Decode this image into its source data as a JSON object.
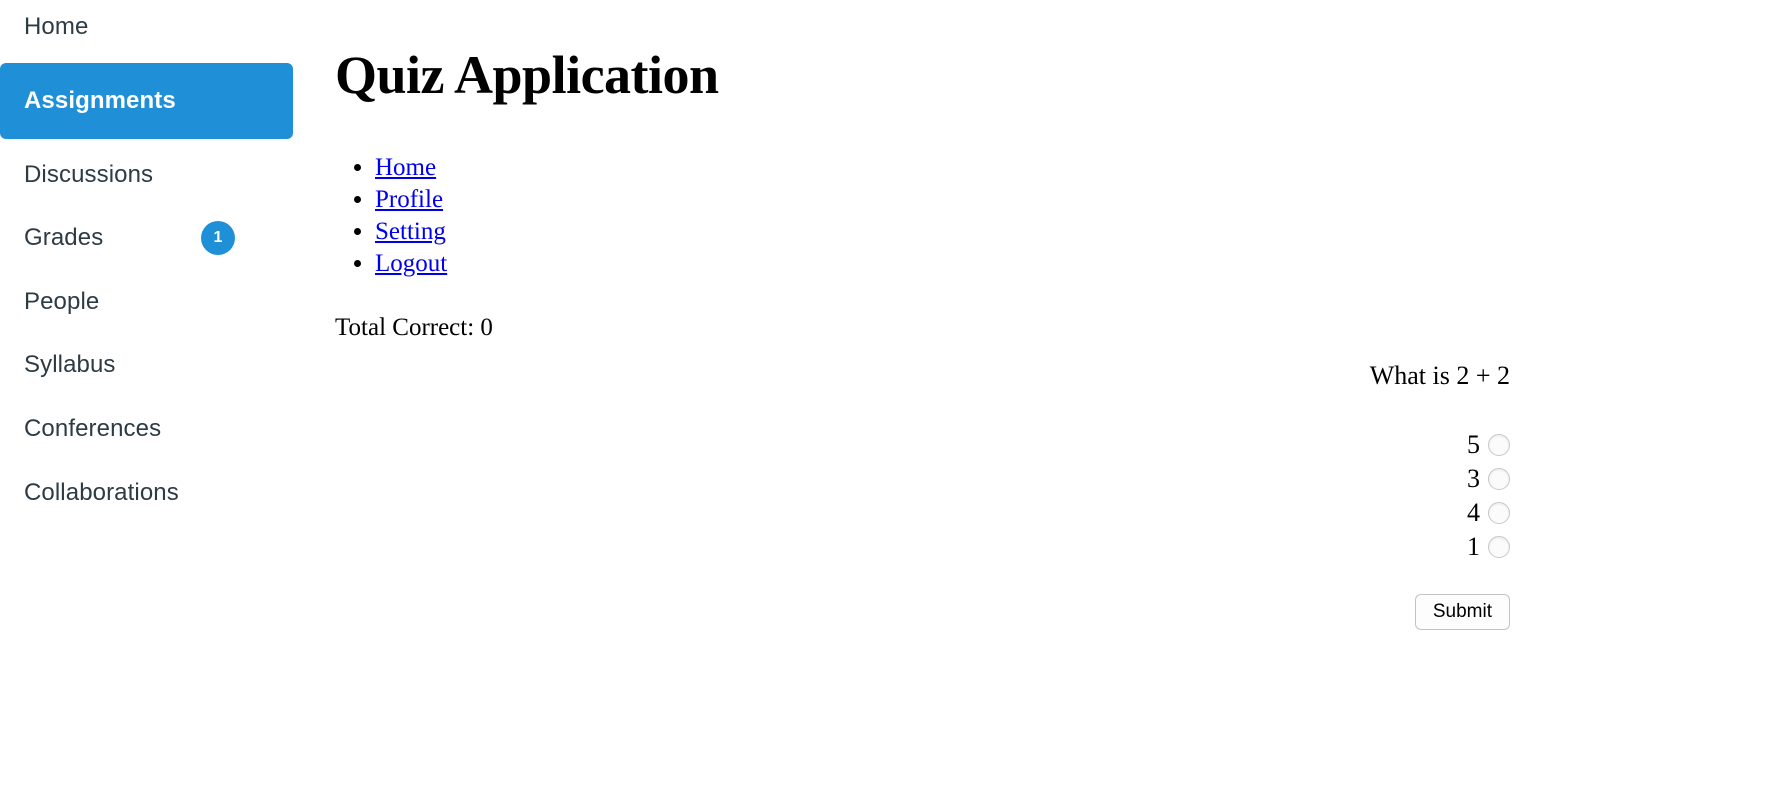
{
  "sidebar": {
    "items": [
      {
        "id": "home",
        "label": "Home",
        "active": false,
        "badge": null
      },
      {
        "id": "assignments",
        "label": "Assignments",
        "active": true,
        "badge": null
      },
      {
        "id": "discussions",
        "label": "Discussions",
        "active": false,
        "badge": null
      },
      {
        "id": "grades",
        "label": "Grades",
        "active": false,
        "badge": "1"
      },
      {
        "id": "people",
        "label": "People",
        "active": false,
        "badge": null
      },
      {
        "id": "syllabus",
        "label": "Syllabus",
        "active": false,
        "badge": null
      },
      {
        "id": "conferences",
        "label": "Conferences",
        "active": false,
        "badge": null
      },
      {
        "id": "collaborations",
        "label": "Collaborations",
        "active": false,
        "badge": null
      }
    ],
    "active_color": "#1f90d8",
    "text_color": "#2D3B45",
    "badge_color": "#1f90d8"
  },
  "main": {
    "title": "Quiz Application",
    "links": [
      {
        "label": "Home"
      },
      {
        "label": "Profile"
      },
      {
        "label": "Setting"
      },
      {
        "label": "Logout"
      }
    ],
    "link_color": "#0000EE",
    "total_correct_text": "Total Correct: 0",
    "total_correct_value": 0
  },
  "quiz": {
    "question": "What is 2 + 2",
    "options": [
      {
        "label": "5",
        "selected": false
      },
      {
        "label": "3",
        "selected": false
      },
      {
        "label": "4",
        "selected": false
      },
      {
        "label": "1",
        "selected": false
      }
    ],
    "submit_label": "Submit"
  }
}
